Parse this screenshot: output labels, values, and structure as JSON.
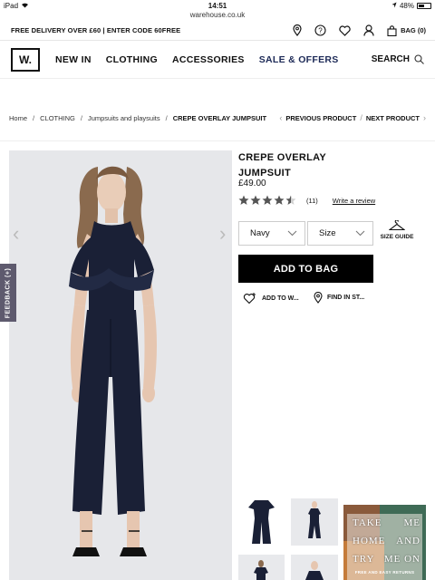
{
  "statusbar": {
    "device": "iPad",
    "time": "14:51",
    "battery": "48%",
    "battery_level": 0.48
  },
  "browser": {
    "url": "warehouse.co.uk"
  },
  "promo": {
    "text": "FREE DELIVERY OVER £60 | ENTER CODE 60FREE"
  },
  "header": {
    "bag_label": "BAG (0)",
    "icons": [
      "location-pin-icon",
      "help-icon",
      "heart-icon",
      "account-icon",
      "shopping-bag-icon"
    ]
  },
  "nav": {
    "logo": "W.",
    "links": [
      "NEW IN",
      "CLOTHING",
      "ACCESSORIES",
      "SALE & OFFERS"
    ],
    "search_label": "SEARCH"
  },
  "breadcrumb": {
    "items": [
      "Home",
      "CLOTHING",
      "Jumpsuits and playsuits",
      "CREPE OVERLAY JUMPSUIT"
    ],
    "separator": "/",
    "previous": "PREVIOUS PRODUCT",
    "next": "NEXT PRODUCT"
  },
  "product": {
    "title_line1": "CREPE OVERLAY",
    "title_line2": "JUMPSUIT",
    "price": "£49.00",
    "rating": 4.5,
    "rating_max": 5,
    "review_count": "(11)",
    "write_review": "Write a review",
    "colour_value": "Navy",
    "size_placeholder": "Size",
    "size_guide": "SIZE GUIDE",
    "add_to_bag": "ADD TO BAG",
    "wishlist": "ADD TO W...",
    "find_in_store": "FIND IN ST..."
  },
  "feedback": {
    "label": "FEEDBACK (+)"
  },
  "promo_thumb": {
    "line1a": "TAKE",
    "line1b": "ME",
    "line2a": "HOME",
    "line2b": "AND",
    "line3a": "TRY",
    "line3b": "ME ON",
    "small": "FREE AND EASY RETURNS"
  },
  "colors": {
    "sale": "#1d2a57",
    "button": "#000000",
    "feedback": "#5e5a6e",
    "garment": "#1a2036"
  }
}
